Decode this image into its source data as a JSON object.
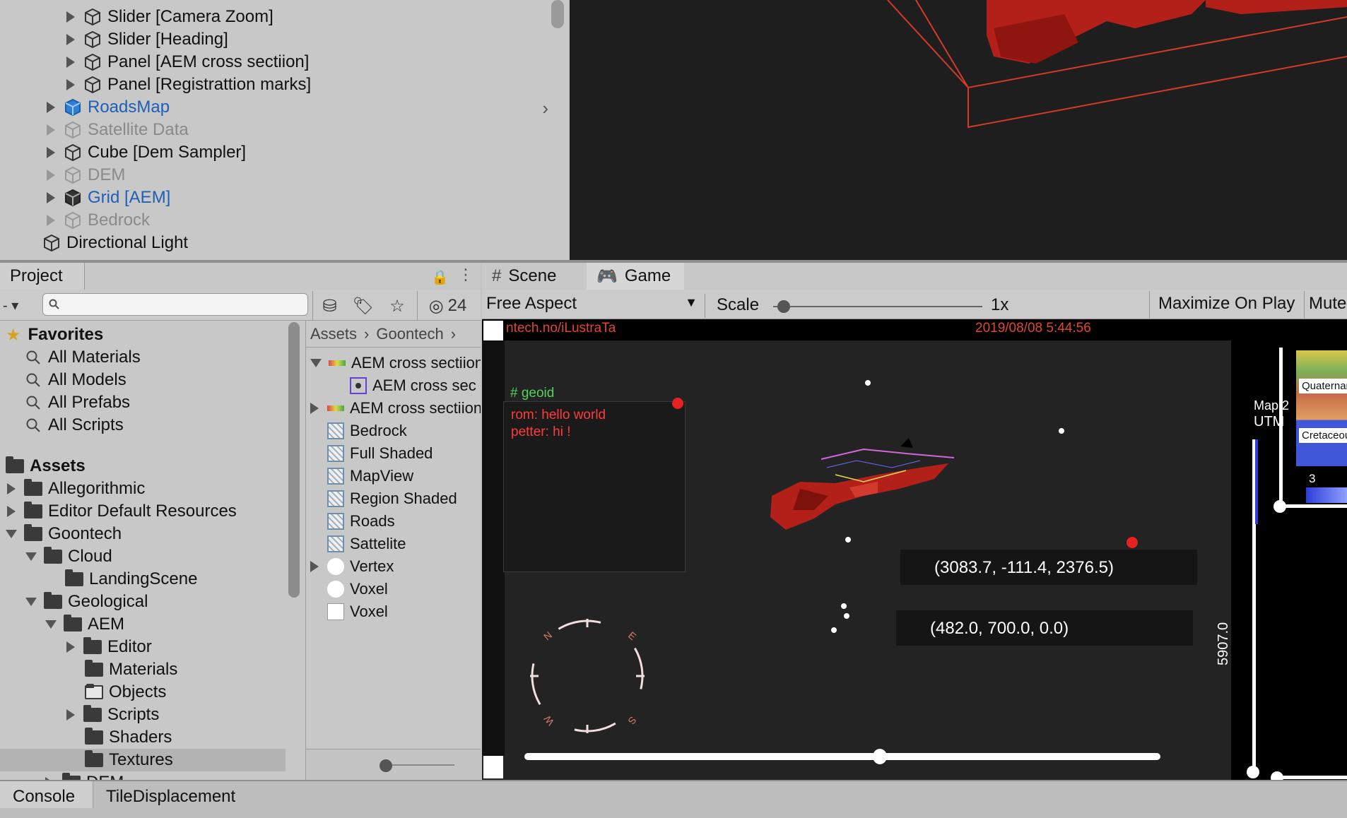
{
  "hierarchy": {
    "items": [
      {
        "label": "Slider [Camera Zoom]"
      },
      {
        "label": "Slider [Heading]"
      },
      {
        "label": "Panel [AEM cross sectiion]"
      },
      {
        "label": "Panel [Registrattion marks]"
      },
      {
        "label": "RoadsMap"
      },
      {
        "label": "Satellite Data"
      },
      {
        "label": "Cube [Dem Sampler]"
      },
      {
        "label": "DEM"
      },
      {
        "label": "Grid [AEM]"
      },
      {
        "label": "Bedrock"
      },
      {
        "label": "Directional Light"
      }
    ]
  },
  "project": {
    "tab_label": "Project",
    "hidden_count": "24",
    "breadcrumb": [
      "Assets",
      "Goontech"
    ],
    "tree": {
      "favorites_label": "Favorites",
      "favorites": [
        "All Materials",
        "All Models",
        "All Prefabs",
        "All Scripts"
      ],
      "assets_label": "Assets",
      "folders": [
        "Allegorithmic",
        "Editor Default Resources",
        "Goontech",
        "Cloud",
        "LandingScene",
        "Geological",
        "AEM",
        "Editor",
        "Materials",
        "Objects",
        "Scripts",
        "Shaders",
        "Textures",
        "DEM"
      ]
    },
    "assets": [
      "AEM cross sectiion",
      "AEM cross sec",
      "AEM cross sectiion",
      "Bedrock",
      "Full Shaded",
      "MapView",
      "Region Shaded",
      "Roads",
      "Sattelite",
      "Vertex",
      "Voxel",
      "Voxel"
    ]
  },
  "game": {
    "tab_scene": "Scene",
    "tab_game": "Game",
    "aspect": "Free Aspect",
    "scale_label": "Scale",
    "scale_value": "1x",
    "scale_fraction": 0.02,
    "maximize_label": "Maximize On Play",
    "mute_label": "Mute",
    "url_text": "ntech.no/iLustraTa",
    "timestamp": "2019/08/08 5:44:56",
    "chat_header": "# geoid",
    "chat_lines": [
      "rom: hello world",
      "petter: hi !"
    ],
    "coord_1": "(3083.7, -111.4, 2376.5)",
    "coord_2": "(482.0, 700.0, 0.0)",
    "compass": {
      "n": "N",
      "e": "E",
      "s": "S",
      "w": "W"
    },
    "side_label_1": "Map 2",
    "side_label_2": "UTM",
    "vertical_value": "5907.0",
    "legend_1": "Quaternary",
    "legend_2": "Cretaceous",
    "legend_num": "3",
    "bottom_slider_fraction": 0.56
  },
  "console": {
    "tab_console": "Console",
    "tab_tile": "TileDisplacement"
  },
  "colors": {
    "accent_blue": "#1f5fb8",
    "game_text_red": "#e0472d",
    "chat_text_red": "#ff3b3b",
    "geoid_green": "#53d15a"
  }
}
